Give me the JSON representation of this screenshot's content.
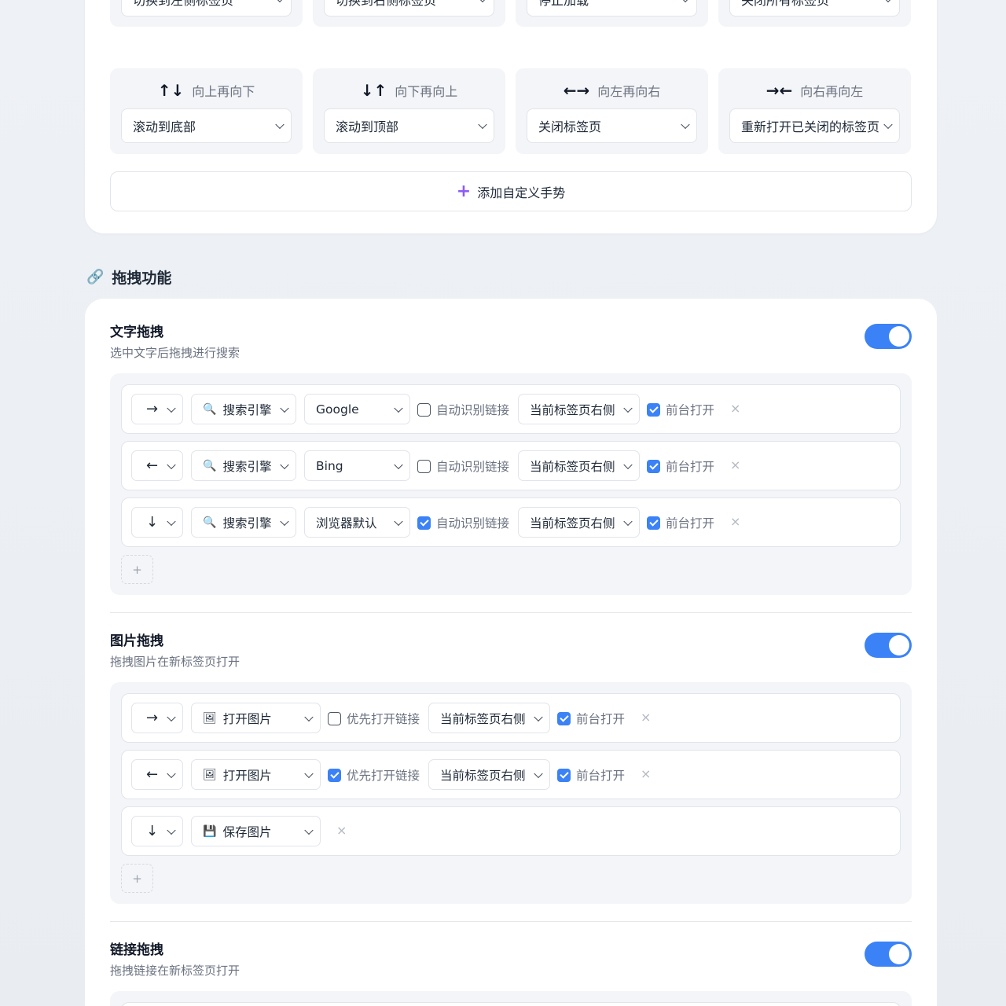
{
  "gestures": {
    "row1": [
      {
        "action": "切换到左侧标签页"
      },
      {
        "action": "切换到右侧标签页"
      },
      {
        "action": "停止加载"
      },
      {
        "action": "关闭所有标签页"
      }
    ],
    "row2": [
      {
        "arrows": "↑↓",
        "label": "向上再向下",
        "action": "滚动到底部"
      },
      {
        "arrows": "↓↑",
        "label": "向下再向上",
        "action": "滚动到顶部"
      },
      {
        "arrows": "←→",
        "label": "向左再向右",
        "action": "关闭标签页"
      },
      {
        "arrows": "→←",
        "label": "向右再向左",
        "action": "重新打开已关闭的标签页"
      }
    ],
    "add_label": "添加自定义手势",
    "add_icon": "+"
  },
  "drag_section": {
    "title": "拖拽功能",
    "icon": "🔗"
  },
  "text_drag": {
    "title": "文字拖拽",
    "desc": "选中文字后拖拽进行搜索",
    "enabled": true,
    "rules": [
      {
        "dir": "→",
        "action": "搜索引擎",
        "engine": "Google",
        "auto_link_label": "自动识别链接",
        "auto_link": false,
        "position": "当前标签页右侧",
        "foreground_label": "前台打开",
        "foreground": true
      },
      {
        "dir": "←",
        "action": "搜索引擎",
        "engine": "Bing",
        "auto_link_label": "自动识别链接",
        "auto_link": false,
        "position": "当前标签页右侧",
        "foreground_label": "前台打开",
        "foreground": true
      },
      {
        "dir": "↓",
        "action": "搜索引擎",
        "engine": "浏览器默认",
        "auto_link_label": "自动识别链接",
        "auto_link": true,
        "position": "当前标签页右侧",
        "foreground_label": "前台打开",
        "foreground": true
      }
    ],
    "remove": "×",
    "add": "+"
  },
  "image_drag": {
    "title": "图片拖拽",
    "desc": "拖拽图片在新标签页打开",
    "enabled": true,
    "rules": [
      {
        "dir": "→",
        "action": "打开图片",
        "prefer_link_label": "优先打开链接",
        "prefer_link": false,
        "position": "当前标签页右侧",
        "foreground_label": "前台打开",
        "foreground": true
      },
      {
        "dir": "←",
        "action": "打开图片",
        "prefer_link_label": "优先打开链接",
        "prefer_link": true,
        "position": "当前标签页右侧",
        "foreground_label": "前台打开",
        "foreground": true
      },
      {
        "dir": "↓",
        "action": "保存图片"
      }
    ],
    "remove": "×",
    "add": "+"
  },
  "link_drag": {
    "title": "链接拖拽",
    "desc": "拖拽链接在新标签页打开",
    "enabled": true
  },
  "colors": {
    "accent": "#3b82f6",
    "plus": "#8b5cf6"
  }
}
